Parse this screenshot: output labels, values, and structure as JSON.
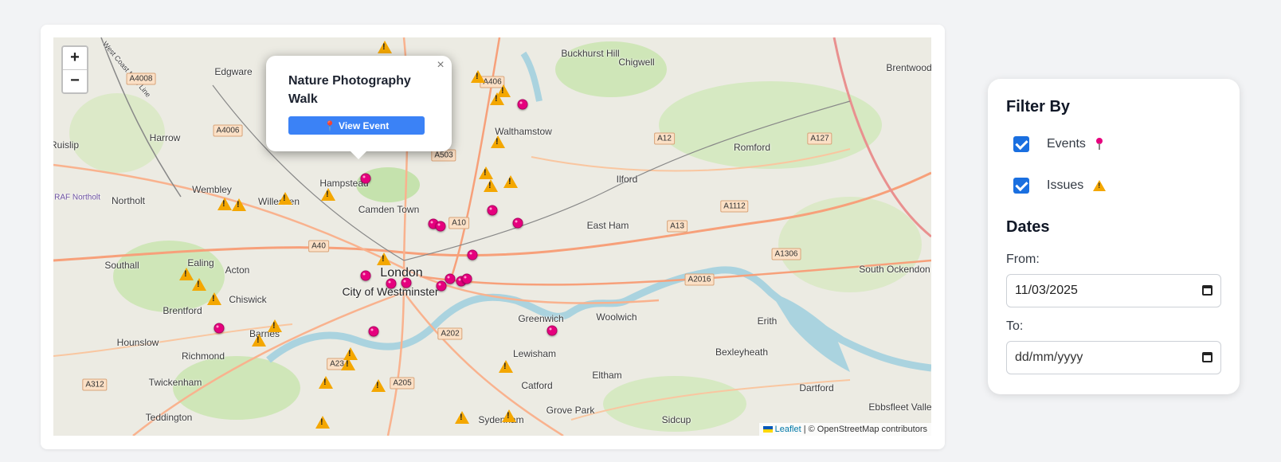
{
  "map": {
    "zoom_in_label": "+",
    "zoom_out_label": "−",
    "places": [
      {
        "name": "London",
        "size": "big"
      },
      {
        "name": "City of Westminster",
        "size": "mid"
      },
      {
        "name": "Hampstead"
      },
      {
        "name": "Camden Town"
      },
      {
        "name": "Wembley"
      },
      {
        "name": "Willesden"
      },
      {
        "name": "Northolt"
      },
      {
        "name": "Harrow"
      },
      {
        "name": "Edgware"
      },
      {
        "name": "Southall"
      },
      {
        "name": "Ealing"
      },
      {
        "name": "Acton"
      },
      {
        "name": "Chiswick"
      },
      {
        "name": "Brentford"
      },
      {
        "name": "Barnes"
      },
      {
        "name": "Hounslow"
      },
      {
        "name": "Richmond"
      },
      {
        "name": "Twickenham"
      },
      {
        "name": "Teddington"
      },
      {
        "name": "Walthamstow"
      },
      {
        "name": "Buckhurst Hill"
      },
      {
        "name": "Chigwell"
      },
      {
        "name": "Ilford"
      },
      {
        "name": "Romford"
      },
      {
        "name": "East Ham"
      },
      {
        "name": "Woolwich"
      },
      {
        "name": "Greenwich"
      },
      {
        "name": "Lewisham"
      },
      {
        "name": "Eltham"
      },
      {
        "name": "Catford"
      },
      {
        "name": "Grove Park"
      },
      {
        "name": "Sydenham"
      },
      {
        "name": "Sidcup"
      },
      {
        "name": "Bexleyheath"
      },
      {
        "name": "Erith"
      },
      {
        "name": "Dartford"
      },
      {
        "name": "Brentwood"
      },
      {
        "name": "South Ockendon"
      },
      {
        "name": "Ebbsfleet Valley"
      },
      {
        "name": "Ruislip"
      },
      {
        "name": "RAF Northolt"
      },
      {
        "name": "West Coast Main Line"
      }
    ],
    "roads": [
      "A4008",
      "A4006",
      "A40",
      "A406",
      "A503",
      "A10",
      "A12",
      "A127",
      "A13",
      "A1112",
      "A1306",
      "A2016",
      "A202",
      "A205",
      "A312",
      "A23"
    ],
    "popup": {
      "close_label": "×",
      "title": "Nature Photography Walk",
      "button_label": "📍 View Event"
    },
    "attribution": {
      "link_text": "Leaflet",
      "text": "| © OpenStreetMap contributors"
    }
  },
  "filter": {
    "heading": "Filter By",
    "events_label": "Events",
    "events_checked": true,
    "issues_label": "Issues",
    "issues_checked": true,
    "dates_heading": "Dates",
    "from_label": "From:",
    "from_value": "11/03/2025",
    "to_label": "To:",
    "to_placeholder": "dd/mm/yyyy"
  },
  "colors": {
    "event_marker": "#e6007e",
    "issue_marker": "#f4a700",
    "accent": "#3b82f6",
    "checkbox": "#1a6fe0"
  }
}
